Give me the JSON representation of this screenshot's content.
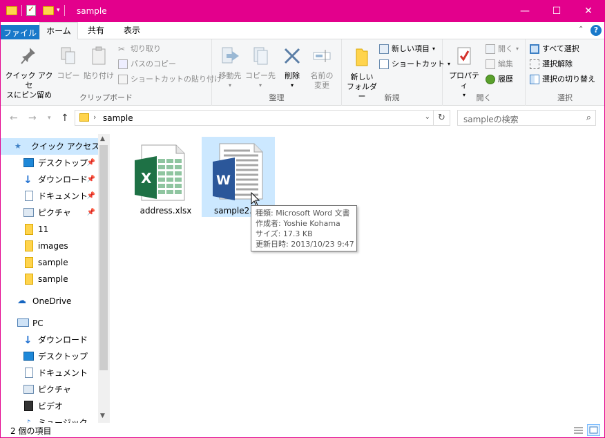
{
  "window": {
    "title": "sample",
    "controls": {
      "minimize": "—",
      "maximize": "☐",
      "close": "✕"
    }
  },
  "ribbon_tabs": {
    "file": "ファイル",
    "home": "ホーム",
    "share": "共有",
    "view": "表示",
    "collapse": "⌃",
    "help": "?"
  },
  "clipboard": {
    "pin_quick_access": [
      "クイック アクセ",
      "スにピン留め"
    ],
    "copy": "コピー",
    "paste": "貼り付け",
    "cut": "切り取り",
    "copy_path": "パスのコピー",
    "paste_shortcut": "ショートカットの貼り付け",
    "group_label": "クリップボード"
  },
  "organize": {
    "move_to": "移動先",
    "copy_to": "コピー先",
    "delete": "削除",
    "rename": [
      "名前の",
      "変更"
    ],
    "group_label": "整理"
  },
  "new_group": {
    "new_folder": [
      "新しい",
      "フォルダー"
    ],
    "new_item": "新しい項目",
    "easy_access": "ショートカット",
    "group_label": "新規"
  },
  "open_group": {
    "properties": "プロパティ",
    "open": "開く",
    "edit": "編集",
    "history": "履歴",
    "group_label": "開く"
  },
  "select_group": {
    "select_all": "すべて選択",
    "select_none": "選択解除",
    "invert": "選択の切り替え",
    "group_label": "選択"
  },
  "address": {
    "path": "sample",
    "refresh": "↻",
    "search_placeholder": "sampleの検索"
  },
  "nav_pane": {
    "quick_access": "クイック アクセス",
    "quick_items": [
      {
        "label": "デスクトップ",
        "pinned": true
      },
      {
        "label": "ダウンロード",
        "pinned": true
      },
      {
        "label": "ドキュメント",
        "pinned": true
      },
      {
        "label": "ピクチャ",
        "pinned": true
      },
      {
        "label": "11",
        "pinned": false
      },
      {
        "label": "images",
        "pinned": false
      },
      {
        "label": "sample",
        "pinned": false
      },
      {
        "label": "sample",
        "pinned": false
      }
    ],
    "onedrive": "OneDrive",
    "pc": "PC",
    "pc_items": [
      {
        "label": "ダウンロード"
      },
      {
        "label": "デスクトップ"
      },
      {
        "label": "ドキュメント"
      },
      {
        "label": "ピクチャ"
      },
      {
        "label": "ビデオ"
      },
      {
        "label": "ミュージック"
      }
    ]
  },
  "files": [
    {
      "name": "address.xlsx",
      "type": "excel",
      "selected": false
    },
    {
      "name": "sample2.docx",
      "display_name": "sample2.do",
      "type": "word",
      "selected": true
    }
  ],
  "tooltip": {
    "type": "種類: Microsoft Word 文書",
    "author": "作成者: Yoshie Kohama",
    "size": "サイズ: 17.3 KB",
    "modified": "更新日時: 2013/10/23 9:47"
  },
  "status": {
    "item_count": "2 個の項目"
  },
  "colors": {
    "title_bar": "#e3008c",
    "file_tab": "#1979ca",
    "selection": "#cce8ff",
    "excel_green": "#1e7145",
    "word_blue": "#2b579a"
  }
}
